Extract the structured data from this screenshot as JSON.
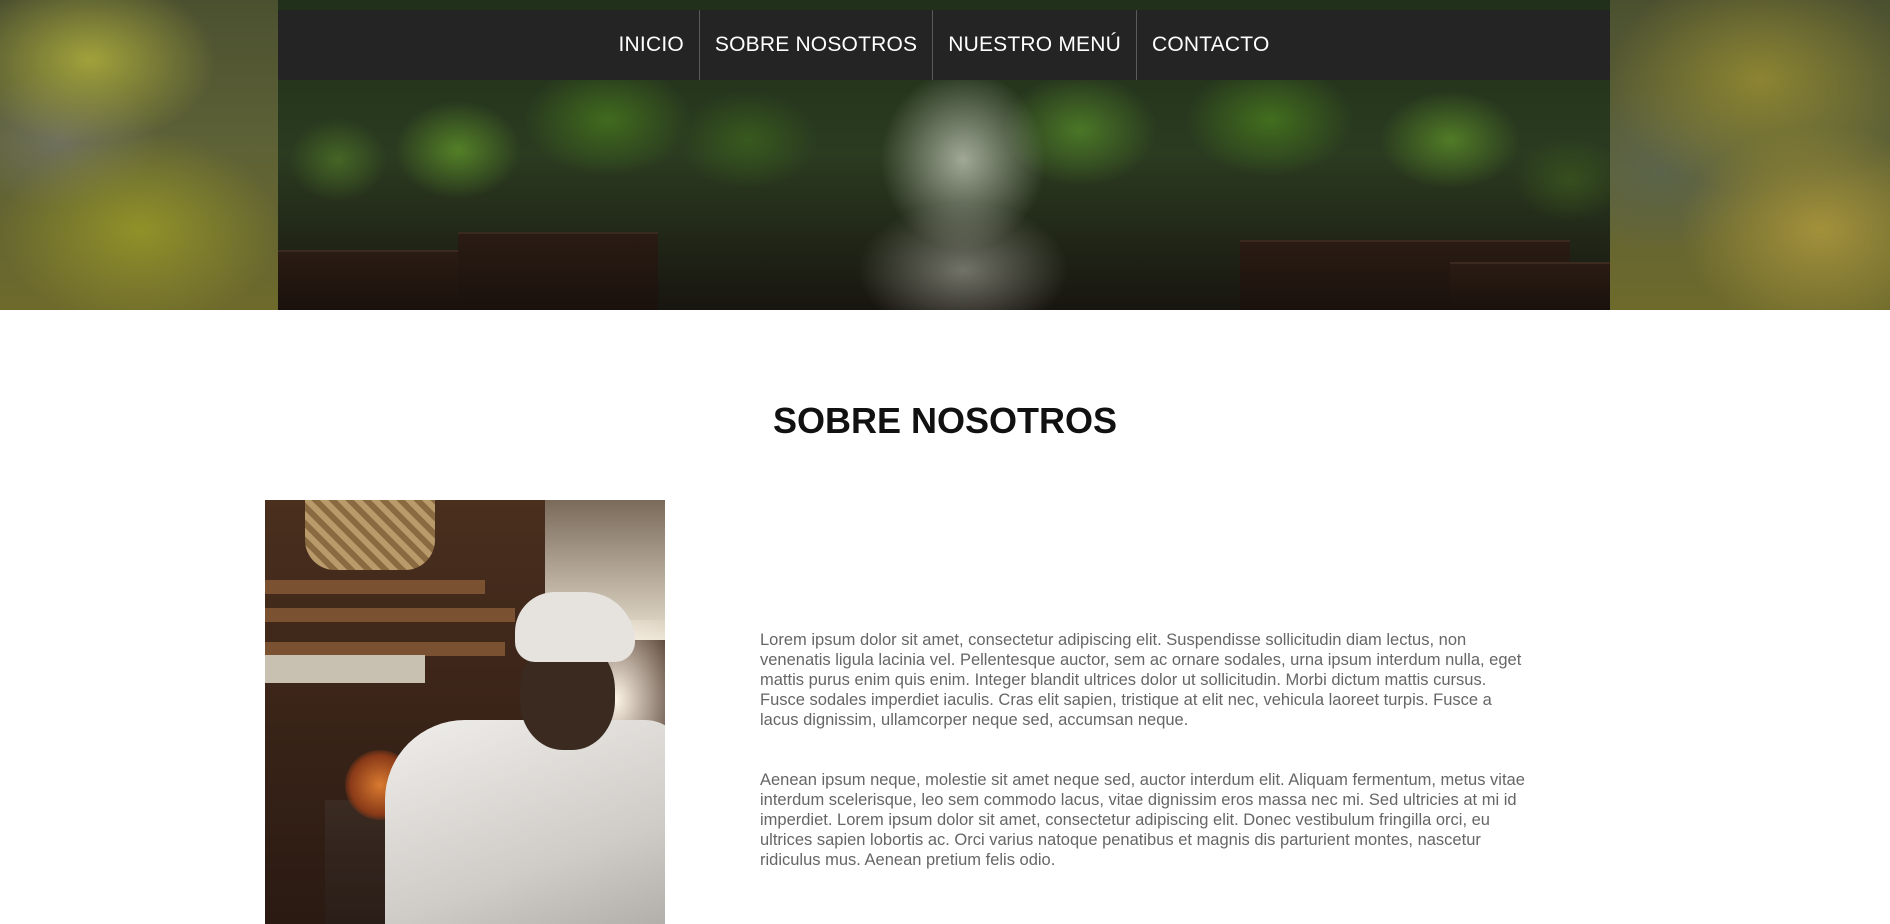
{
  "nav": {
    "items": [
      {
        "label": "INICIO"
      },
      {
        "label": "SOBRE NOSOTROS"
      },
      {
        "label": "NUESTRO MENÚ"
      },
      {
        "label": "CONTACTO"
      }
    ]
  },
  "about": {
    "title": "SOBRE NOSOTROS",
    "paragraphs": [
      "Lorem ipsum dolor sit amet, consectetur adipiscing elit. Suspendisse sollicitudin diam lectus, non venenatis ligula lacinia vel. Pellentesque auctor, sem ac ornare sodales, urna ipsum interdum nulla, eget mattis purus enim quis enim. Integer blandit ultrices dolor ut sollicitudin. Morbi dictum mattis cursus. Fusce sodales imperdiet iaculis. Cras elit sapien, tristique at elit nec, vehicula laoreet turpis. Fusce a lacus dignissim, ullamcorper neque sed, accumsan neque.",
      "Aenean ipsum neque, molestie sit amet neque sed, auctor interdum elit. Aliquam fermentum, metus vitae interdum scelerisque, leo sem commodo lacus, vitae dignissim eros massa nec mi. Sed ultricies at mi id imperdiet. Lorem ipsum dolor sit amet, consectetur adipiscing elit. Donec vestibulum fringilla orci, eu ultrices sapien lobortis ac. Orci varius natoque penatibus et magnis dis parturient montes, nascetur ridiculus mus. Aenean pretium felis odio."
    ]
  }
}
